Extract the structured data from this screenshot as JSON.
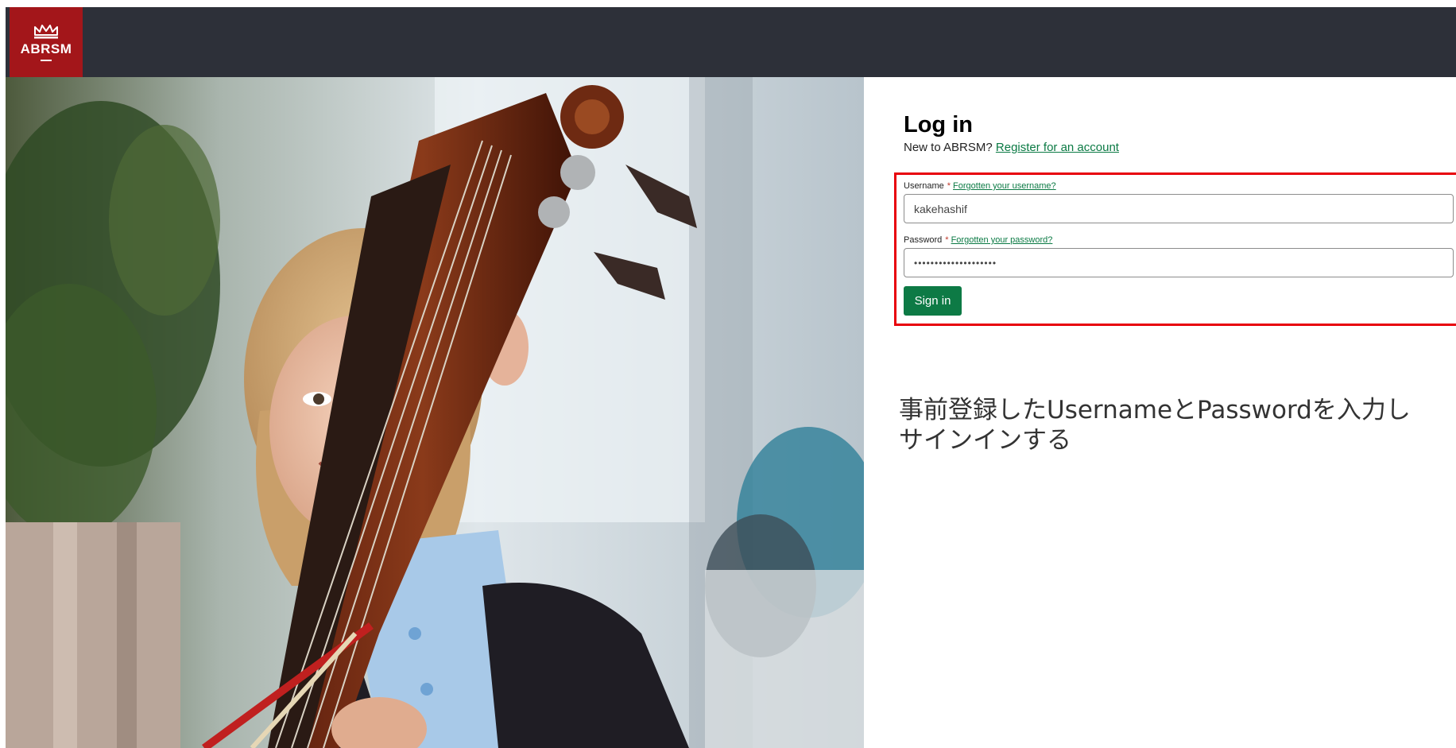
{
  "brand": {
    "logo_text": "ABRSM",
    "icon": "crown-icon",
    "logo_color": "#a3161a",
    "topbar_color": "#2d3039"
  },
  "hero": {
    "icon": "girl-with-double-bass-photo"
  },
  "login": {
    "title": "Log in",
    "new_prompt": "New to ABRSM?",
    "register_link": "Register for an account",
    "username_label": "Username",
    "required_mark": "*",
    "forgot_username": "Forgotten your username?",
    "username_value": "kakehashif",
    "password_label": "Password",
    "forgot_password": "Forgotten your password?",
    "password_value": "••••••••••••••••••••",
    "signin_label": "Sign in",
    "button_color": "#0d7a45",
    "link_color": "#0b7a44",
    "highlight_color": "#e8000b"
  },
  "annotation": {
    "line1": "事前登録したUsernameとPasswordを入力し",
    "line2": "サインインする"
  }
}
